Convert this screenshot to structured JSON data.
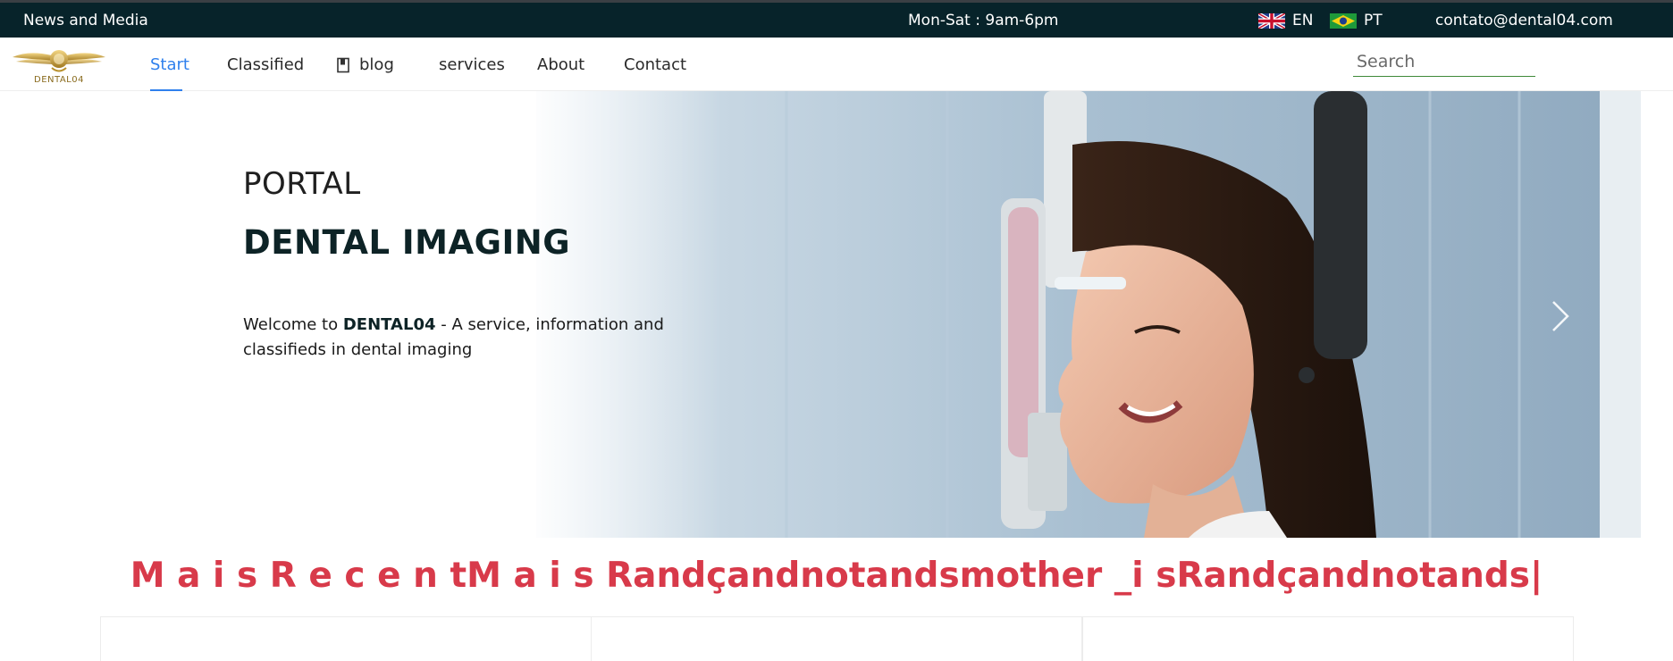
{
  "topbar": {
    "left_text": "News and Media",
    "hours": "Mon-Sat : 9am-6pm",
    "lang_en": "EN",
    "lang_pt": "PT",
    "email": "contato@dental04.com"
  },
  "logo": {
    "text": "DENTAL04"
  },
  "nav": {
    "items": [
      {
        "label": "Start"
      },
      {
        "label": "Classified"
      },
      {
        "label": "blog"
      },
      {
        "label": "services"
      },
      {
        "label": "About"
      },
      {
        "label": "Contact"
      }
    ],
    "active_label": "Start"
  },
  "search": {
    "placeholder": "Search"
  },
  "hero": {
    "title_small": "PORTAL",
    "title_big": "DENTAL IMAGING",
    "text_prefix": "Welcome to ",
    "text_bold": "DENTAL04",
    "text_suffix": " - A service, information and classifieds in dental imaging"
  },
  "headline": "M a i s R e c e n tM a i s Randçandnotandsmother _i sRandçandnotands|",
  "colors": {
    "topbar_bg": "#07232a",
    "accent_blue": "#2f80ed",
    "headline_red": "#d83a4a",
    "search_underline": "#3f8a3a"
  }
}
